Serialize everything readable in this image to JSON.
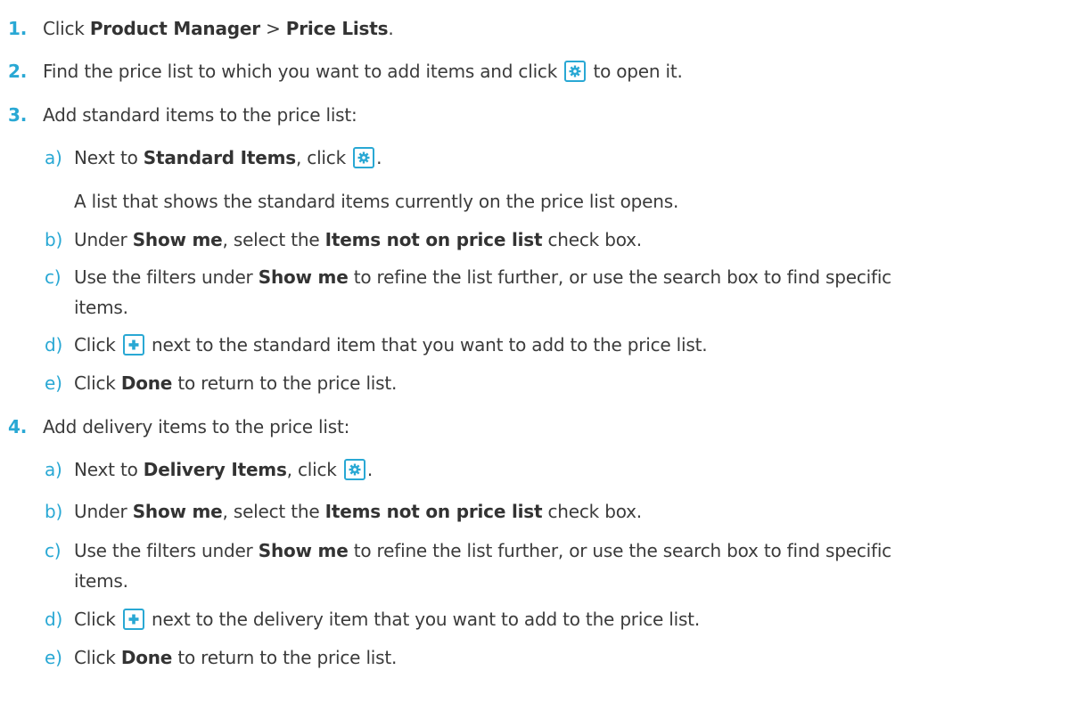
{
  "steps": [
    {
      "num": "1.",
      "parts": [
        "Click ",
        "Product Manager",
        " > ",
        "Price Lists",
        "."
      ]
    },
    {
      "num": "2.",
      "parts": [
        "Find the price list to which you want to add items and click ",
        "to open it."
      ],
      "icon": "gear-icon"
    },
    {
      "num": "3.",
      "text": "Add standard items to the price list:",
      "subs": [
        {
          "letter": "a)",
          "parts": [
            "Next to ",
            "Standard Items",
            ", click ",
            "."
          ],
          "icon": "gear-icon",
          "note": "A list that shows the standard items currently on the price list opens."
        },
        {
          "letter": "b)",
          "parts": [
            "Under ",
            "Show me",
            ", select the ",
            "Items not on price list",
            " check box."
          ]
        },
        {
          "letter": "c)",
          "parts": [
            "Use the filters under ",
            "Show me",
            " to refine the list further, or use the search box to find specific",
            "items."
          ]
        },
        {
          "letter": "d)",
          "parts": [
            "Click ",
            "next to the standard item that you want to add to the price list."
          ],
          "icon": "plus-icon"
        },
        {
          "letter": "e)",
          "parts": [
            "Click ",
            "Done",
            " to return to the price list."
          ]
        }
      ]
    },
    {
      "num": "4.",
      "text": "Add delivery items to the price list:",
      "subs": [
        {
          "letter": "a)",
          "parts": [
            "Next to ",
            "Delivery Items",
            ", click ",
            "."
          ],
          "icon": "gear-icon"
        },
        {
          "letter": "b)",
          "parts": [
            "Under ",
            "Show me",
            ", select the ",
            "Items not on price list",
            " check box."
          ]
        },
        {
          "letter": "c)",
          "parts": [
            "Use the filters under ",
            "Show me",
            " to refine the list further, or use the search box to find specific",
            "items."
          ]
        },
        {
          "letter": "d)",
          "parts": [
            "Click ",
            "next to the delivery item that you want to add to the price list."
          ],
          "icon": "plus-icon"
        },
        {
          "letter": "e)",
          "parts": [
            "Click ",
            "Done",
            " to return to the price list."
          ]
        }
      ]
    }
  ],
  "colors": {
    "accent": "#29a8d4",
    "text": "#3b3b3b"
  }
}
